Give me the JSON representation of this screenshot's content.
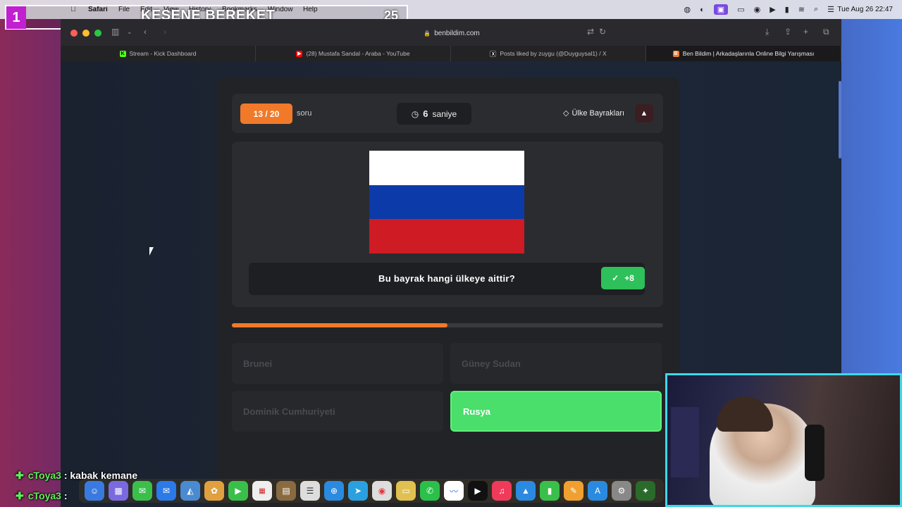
{
  "menubar": {
    "app": "Safari",
    "items": [
      "File",
      "Edit",
      "View",
      "History",
      "Bookmarks",
      "Window",
      "Help"
    ],
    "clock": "Tue Aug 26  22:47"
  },
  "overlay": {
    "number": "1",
    "title": "KESENE BEREKET",
    "count": "25"
  },
  "browser": {
    "url": "benbildim.com",
    "tabs": [
      {
        "label": "Stream - Kick Dashboard",
        "color": "#53fc18"
      },
      {
        "label": "(28) Mustafa Sandal - Araba - YouTube",
        "color": "#ff0000"
      },
      {
        "label": "Posts liked by zuygu (@Duyguysal1) / X",
        "color": "#000000"
      },
      {
        "label": "Ben Bildim | Arkadaşlarınla Online Bilgi Yarışması",
        "color": "#f07a2a"
      }
    ]
  },
  "quiz": {
    "question_counter": "13 / 20",
    "question_word": "soru",
    "timer_value": "6",
    "timer_unit": "saniye",
    "category": "Ülke Bayrakları",
    "question": "Bu bayrak hangi ülkeye aittir?",
    "points": "+8",
    "progress": 0.5,
    "flag_colors": [
      "#ffffff",
      "#0c3aa8",
      "#cf1b24"
    ],
    "answers": [
      {
        "label": "Brunei",
        "correct": false
      },
      {
        "label": "Güney Sudan",
        "correct": false
      },
      {
        "label": "Dominik Cumhuriyeti",
        "correct": false
      },
      {
        "label": "Rusya",
        "correct": true
      }
    ]
  },
  "chat": [
    {
      "user": "cToya3",
      "message": ": kabak kemane"
    },
    {
      "user": "cToya3",
      "message": ":"
    }
  ]
}
